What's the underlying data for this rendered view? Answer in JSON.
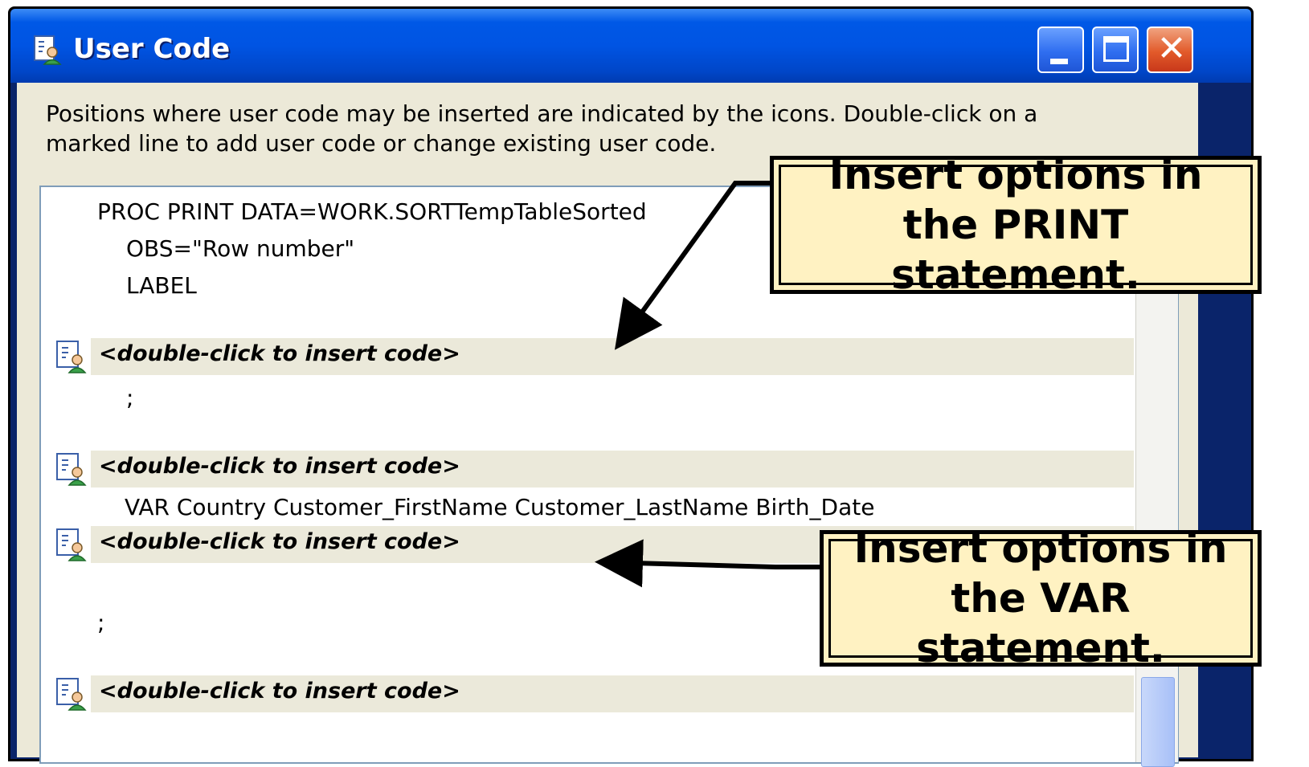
{
  "window": {
    "title": "User Code",
    "colors": {
      "titlebar": "#0054e3",
      "client": "#ece9d8",
      "callout_fill": "#fff2c2"
    }
  },
  "controls": {
    "minimize_icon": "minimize-icon",
    "maximize_icon": "maximize-icon",
    "close_icon": "close-icon"
  },
  "instructions": {
    "line1": "Positions where user code may be inserted are indicated by the icons. Double-click on a",
    "line2": "marked line to add user code or change existing user code."
  },
  "editor": {
    "code_lines": {
      "proc_print": "PROC PRINT DATA=WORK.SORTTempTableSorted",
      "obs": "OBS=\"Row number\"",
      "label": "LABEL",
      "semicolon_1": ";",
      "var": "VAR Country Customer_FirstName Customer_LastName Birth_Date",
      "semicolon_2": ";"
    },
    "insert_points": [
      {
        "label": "<double-click to insert code>",
        "icon": "user-code-icon"
      },
      {
        "label": "<double-click to insert code>",
        "icon": "user-code-icon"
      },
      {
        "label": "<double-click to insert code>",
        "icon": "user-code-icon"
      },
      {
        "label": "<double-click to insert code>",
        "icon": "user-code-icon"
      }
    ]
  },
  "callouts": {
    "print": {
      "line1": "Insert options in",
      "line2": "the PRINT statement."
    },
    "var": {
      "line1": "Insert options in",
      "line2": "the VAR statement."
    }
  }
}
